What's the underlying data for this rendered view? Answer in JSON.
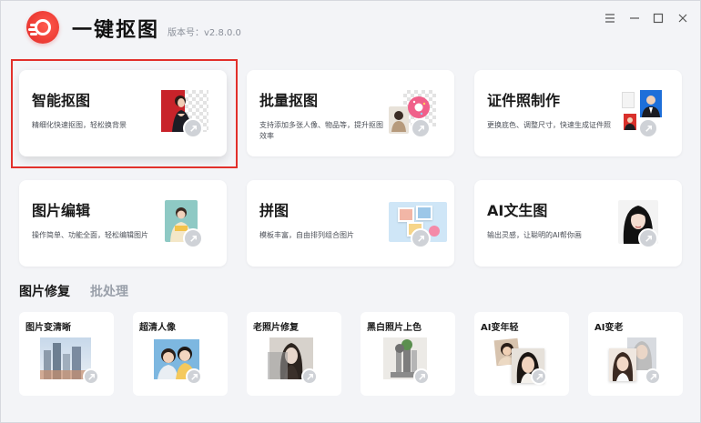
{
  "app": {
    "title": "一键抠图",
    "version": "版本号：v2.8.0.0",
    "brand_color": "#e2302b"
  },
  "window_controls": [
    {
      "name": "menu-icon",
      "glyph": "☰"
    },
    {
      "name": "minimize-icon",
      "glyph": "—"
    },
    {
      "name": "maximize-icon",
      "glyph": "☐"
    },
    {
      "name": "close-icon",
      "glyph": "✕"
    }
  ],
  "cards": [
    {
      "title": "智能抠图",
      "desc": "精细化快速抠图，轻松换背景",
      "icon": "portrait-cutout-icon"
    },
    {
      "title": "批量抠图",
      "desc": "支持添加多张人像、物品等，提升抠图效率",
      "icon": "donut-cutout-icon"
    },
    {
      "title": "证件照制作",
      "desc": "更换底色、调整尺寸，快速生成证件照",
      "icon": "id-photo-icon"
    },
    {
      "title": "图片编辑",
      "desc": "操作简单、功能全面，轻松编辑图片",
      "icon": "image-edit-icon"
    },
    {
      "title": "拼图",
      "desc": "模板丰富，自由排列组合图片",
      "icon": "collage-icon"
    },
    {
      "title": "AI文生图",
      "desc": "输出灵感，让聪明的AI帮你画",
      "icon": "ai-portrait-icon"
    }
  ],
  "section": {
    "tab_active": "图片修复",
    "tab_inactive": "批处理"
  },
  "tools": [
    {
      "title": "图片变清晰",
      "icon": "city-photo-icon"
    },
    {
      "title": "超清人像",
      "icon": "couple-photo-icon"
    },
    {
      "title": "老照片修复",
      "icon": "old-photo-icon"
    },
    {
      "title": "黑白照片上色",
      "icon": "colorize-photo-icon"
    },
    {
      "title": "AI变年轻",
      "icon": "young-face-icon"
    },
    {
      "title": "AI变老",
      "icon": "old-face-icon"
    }
  ]
}
